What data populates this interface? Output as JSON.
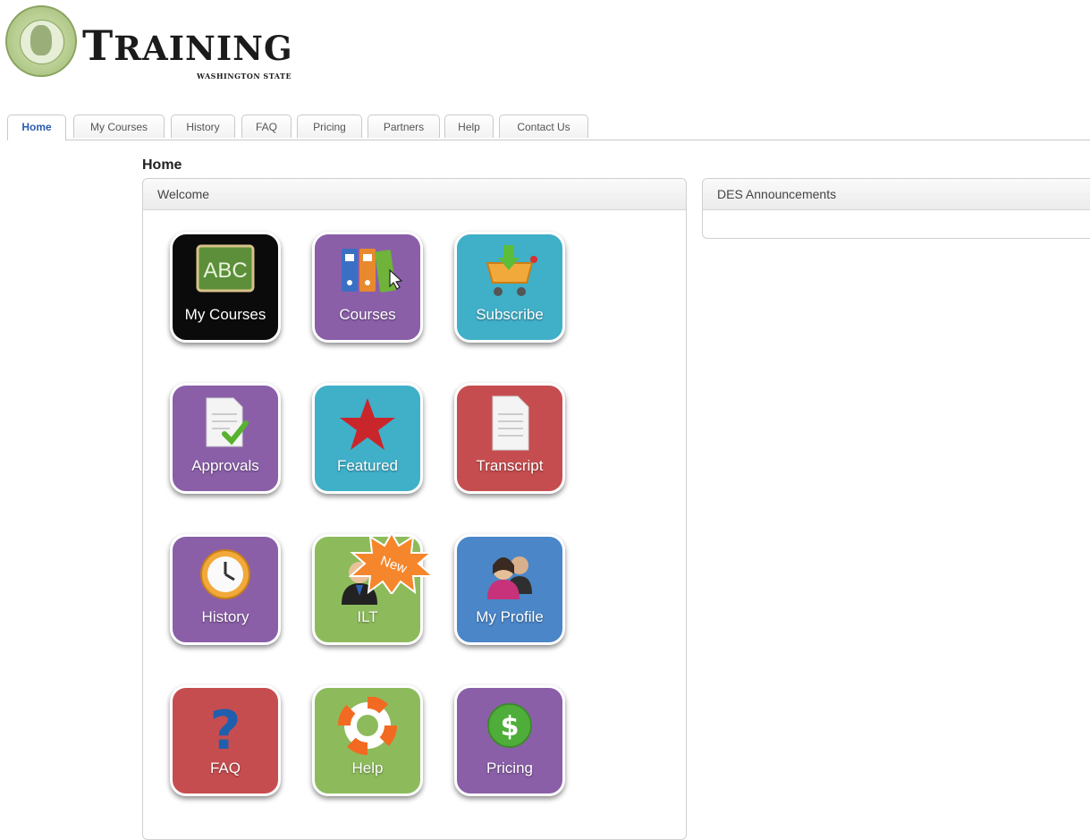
{
  "header": {
    "brand_first": "T",
    "brand_rest": "RAINING",
    "brand_sub": "WASHINGTON STATE"
  },
  "tabs": [
    {
      "label": "Home",
      "active": true
    },
    {
      "label": "My Courses"
    },
    {
      "label": "History"
    },
    {
      "label": "FAQ"
    },
    {
      "label": "Pricing"
    },
    {
      "label": "Partners"
    },
    {
      "label": "Help"
    },
    {
      "label": "Contact Us"
    }
  ],
  "page": {
    "title": "Home"
  },
  "welcome": {
    "title": "Welcome"
  },
  "announcements": {
    "title": "DES Announcements"
  },
  "tiles": [
    {
      "label": "My Courses",
      "icon": "chalkboard-abc-icon",
      "color": "#0b0b0b"
    },
    {
      "label": "Courses",
      "icon": "binders-icon",
      "color": "#8a5fa8"
    },
    {
      "label": "Subscribe",
      "icon": "shopping-cart-icon",
      "color": "#40afc8"
    },
    {
      "label": "Approvals",
      "icon": "document-check-icon",
      "color": "#8a5fa8"
    },
    {
      "label": "Featured",
      "icon": "star-icon",
      "color": "#40afc8"
    },
    {
      "label": "Transcript",
      "icon": "document-icon",
      "color": "#c64d4f"
    },
    {
      "label": "History",
      "icon": "clock-icon",
      "color": "#8a5fa8"
    },
    {
      "label": "ILT",
      "icon": "instructor-icon",
      "color": "#8dbb5c",
      "badge": "New"
    },
    {
      "label": "My Profile",
      "icon": "people-icon",
      "color": "#4a86c8"
    },
    {
      "label": "FAQ",
      "icon": "question-icon",
      "color": "#c64d4f"
    },
    {
      "label": "Help",
      "icon": "lifebuoy-icon",
      "color": "#8dbb5c"
    },
    {
      "label": "Pricing",
      "icon": "dollar-coin-icon",
      "color": "#8a5fa8"
    }
  ]
}
